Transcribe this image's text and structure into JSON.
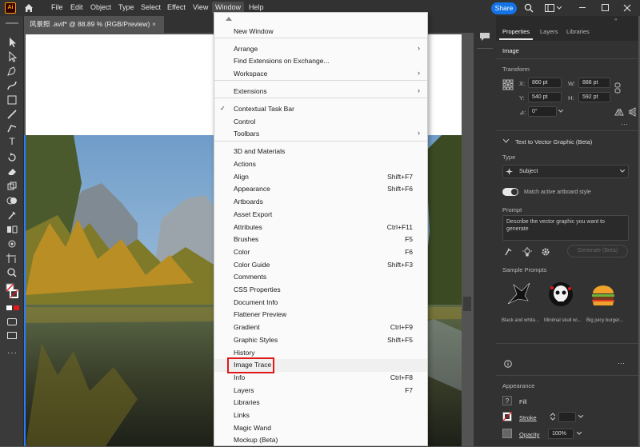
{
  "menubar": {
    "logo": "Ai",
    "items": [
      "File",
      "Edit",
      "Object",
      "Type",
      "Select",
      "Effect",
      "View",
      "Window",
      "Help"
    ],
    "share": "Share"
  },
  "document_tab": {
    "title": "风景照 .avif* @ 88.89 % (RGB/Preview)",
    "close": "×"
  },
  "window_menu": {
    "items": [
      {
        "label": "New Window",
        "shortcut": "",
        "submenu": false,
        "checked": false
      },
      {
        "label": "Arrange",
        "shortcut": "",
        "submenu": true,
        "checked": false
      },
      {
        "label": "Find Extensions on Exchange...",
        "shortcut": "",
        "submenu": false,
        "checked": false
      },
      {
        "label": "Workspace",
        "shortcut": "",
        "submenu": true,
        "checked": false
      },
      {
        "label": "Extensions",
        "shortcut": "",
        "submenu": true,
        "checked": false
      },
      {
        "label": "Contextual Task Bar",
        "shortcut": "",
        "submenu": false,
        "checked": true
      },
      {
        "label": "Control",
        "shortcut": "",
        "submenu": false,
        "checked": false
      },
      {
        "label": "Toolbars",
        "shortcut": "",
        "submenu": true,
        "checked": false
      },
      {
        "label": "3D and Materials",
        "shortcut": "",
        "submenu": false,
        "checked": false
      },
      {
        "label": "Actions",
        "shortcut": "",
        "submenu": false,
        "checked": false
      },
      {
        "label": "Align",
        "shortcut": "Shift+F7",
        "submenu": false,
        "checked": false
      },
      {
        "label": "Appearance",
        "shortcut": "Shift+F6",
        "submenu": false,
        "checked": false
      },
      {
        "label": "Artboards",
        "shortcut": "",
        "submenu": false,
        "checked": false
      },
      {
        "label": "Asset Export",
        "shortcut": "",
        "submenu": false,
        "checked": false
      },
      {
        "label": "Attributes",
        "shortcut": "Ctrl+F11",
        "submenu": false,
        "checked": false
      },
      {
        "label": "Brushes",
        "shortcut": "F5",
        "submenu": false,
        "checked": false
      },
      {
        "label": "Color",
        "shortcut": "F6",
        "submenu": false,
        "checked": false
      },
      {
        "label": "Color Guide",
        "shortcut": "Shift+F3",
        "submenu": false,
        "checked": false
      },
      {
        "label": "Comments",
        "shortcut": "",
        "submenu": false,
        "checked": false
      },
      {
        "label": "CSS Properties",
        "shortcut": "",
        "submenu": false,
        "checked": false
      },
      {
        "label": "Document Info",
        "shortcut": "",
        "submenu": false,
        "checked": false
      },
      {
        "label": "Flattener Preview",
        "shortcut": "",
        "submenu": false,
        "checked": false
      },
      {
        "label": "Gradient",
        "shortcut": "Ctrl+F9",
        "submenu": false,
        "checked": false
      },
      {
        "label": "Graphic Styles",
        "shortcut": "Shift+F5",
        "submenu": false,
        "checked": false
      },
      {
        "label": "History",
        "shortcut": "",
        "submenu": false,
        "checked": false
      },
      {
        "label": "Image Trace",
        "shortcut": "",
        "submenu": false,
        "checked": false
      },
      {
        "label": "Info",
        "shortcut": "Ctrl+F8",
        "submenu": false,
        "checked": false
      },
      {
        "label": "Layers",
        "shortcut": "F7",
        "submenu": false,
        "checked": false
      },
      {
        "label": "Libraries",
        "shortcut": "",
        "submenu": false,
        "checked": false
      },
      {
        "label": "Links",
        "shortcut": "",
        "submenu": false,
        "checked": false
      },
      {
        "label": "Magic Wand",
        "shortcut": "",
        "submenu": false,
        "checked": false
      },
      {
        "label": "Mockup (Beta)",
        "shortcut": "",
        "submenu": false,
        "checked": false
      }
    ],
    "highlighted": "Image Trace",
    "highlight_color": "#e11919"
  },
  "properties": {
    "tabs": [
      "Properties",
      "Layers",
      "Libraries"
    ],
    "active_tab": "Properties",
    "selection": "Image",
    "transform": {
      "title": "Transform",
      "x_label": "X:",
      "x": "860 pt",
      "y_label": "Y:",
      "y": "540 pt",
      "w_label": "W:",
      "w": "888 pt",
      "h_label": "H:",
      "h": "592 pt",
      "angle_label": "⊿:",
      "angle": "0°"
    },
    "t2v": {
      "title": "Text to Vector Graphic (Beta)",
      "type_label": "Type",
      "type_value": "Subject",
      "match_label": "Match active artboard style",
      "prompt_label": "Prompt",
      "prompt_placeholder": "Describe the vector graphic you want to generate",
      "generate": "Generate (Beta)",
      "samples_label": "Sample Prompts",
      "samples": [
        "Black and white...",
        "Minimal skull wi...",
        "Big juicy burger..."
      ]
    },
    "appearance": {
      "title": "Appearance",
      "fill": "Fill",
      "stroke": "Stroke",
      "opacity": "Opacity",
      "opacity_value": "100%"
    }
  },
  "colors": {
    "accent": "#1473e6",
    "ai_orange": "#ff9a00",
    "highlight_red": "#e11919"
  }
}
